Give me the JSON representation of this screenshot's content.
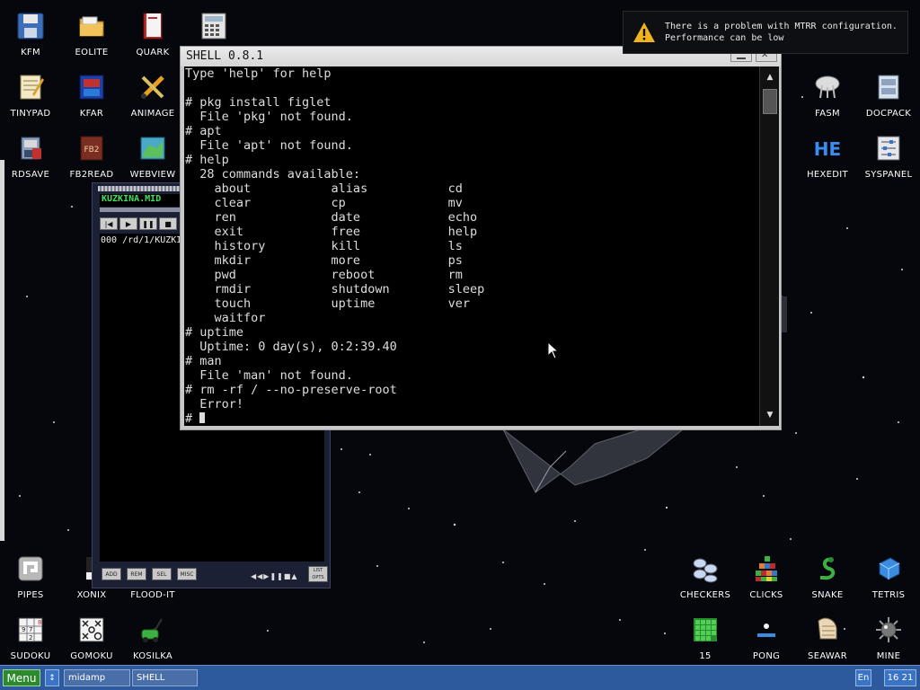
{
  "desktop": {
    "icons": [
      {
        "label": "KFM",
        "icon": "floppy-icon"
      },
      {
        "label": "EOLITE",
        "icon": "folder-icon"
      },
      {
        "label": "QUARK",
        "icon": "book-icon"
      },
      {
        "label": "",
        "icon": "calculator-icon"
      },
      {
        "label": "TINYPAD",
        "icon": "notepad-icon"
      },
      {
        "label": "KFAR",
        "icon": "kfar-icon"
      },
      {
        "label": "ANIMAGE",
        "icon": "paint-icon"
      },
      {
        "label": "RDSAVE",
        "icon": "rdsave-icon"
      },
      {
        "label": "FB2READ",
        "icon": "fb2-book-icon"
      },
      {
        "label": "WEBVIEW",
        "icon": "globe-map-icon"
      },
      {
        "label": "FASM",
        "icon": "fasm-icon"
      },
      {
        "label": "DOCPACK",
        "icon": "docpack-icon"
      },
      {
        "label": "HEXEDIT",
        "icon": "hex-icon"
      },
      {
        "label": "SYSPANEL",
        "icon": "sliders-icon"
      },
      {
        "label": "PIPES",
        "icon": "pipes-icon"
      },
      {
        "label": "XONIX",
        "icon": "xonix-icon"
      },
      {
        "label": "FLOOD-IT",
        "icon": "flood-icon"
      },
      {
        "label": "SUDOKU",
        "icon": "sudoku-icon"
      },
      {
        "label": "GOMOKU",
        "icon": "gomoku-icon"
      },
      {
        "label": "KOSILKA",
        "icon": "lawnmower-icon"
      },
      {
        "label": "CHECKERS",
        "icon": "checkers-icon"
      },
      {
        "label": "CLICKS",
        "icon": "clicks-icon"
      },
      {
        "label": "SNAKE",
        "icon": "snake-icon"
      },
      {
        "label": "TETRIS",
        "icon": "tetris-icon"
      },
      {
        "label": "15",
        "icon": "fifteen-icon"
      },
      {
        "label": "PONG",
        "icon": "pong-icon"
      },
      {
        "label": "SEAWAR",
        "icon": "seawar-icon"
      },
      {
        "label": "MINE",
        "icon": "mine-icon"
      }
    ]
  },
  "notification": {
    "line1": "There is a problem with MTRR configuration.",
    "line2": "Performance can be low"
  },
  "shell": {
    "title": "SHELL 0.8.1",
    "prompt": "#",
    "output": "Type 'help' for help\n\n# pkg install figlet\n  File 'pkg' not found.\n# apt\n  File 'apt' not found.\n# help\n  28 commands available:\n    about           alias           cd\n    clear           cp              mv\n    ren             date            echo\n    exit            free            help\n    history         kill            ls\n    mkdir           more            ps\n    pwd             reboot          rm\n    rmdir           shutdown        sleep\n    touch           uptime          ver\n    waitfor\n# uptime\n  Uptime: 0 day(s), 0:2:39.40\n# man\n  File 'man' not found.\n# rm -rf / --no-preserve-root\n  Error!"
  },
  "midamp": {
    "track": "KUZKINA.MID",
    "playlist_item": "000 /rd/1/KUZKI",
    "buttons": [
      "ADD",
      "REM",
      "SEL",
      "MISC"
    ],
    "list_opts": "LIST OPTS"
  },
  "taskbar": {
    "menu_label": "Menu",
    "switch_label": "↕",
    "tasks": [
      "midamp",
      "SHELL"
    ],
    "lang": "En",
    "clock": "16 21"
  }
}
